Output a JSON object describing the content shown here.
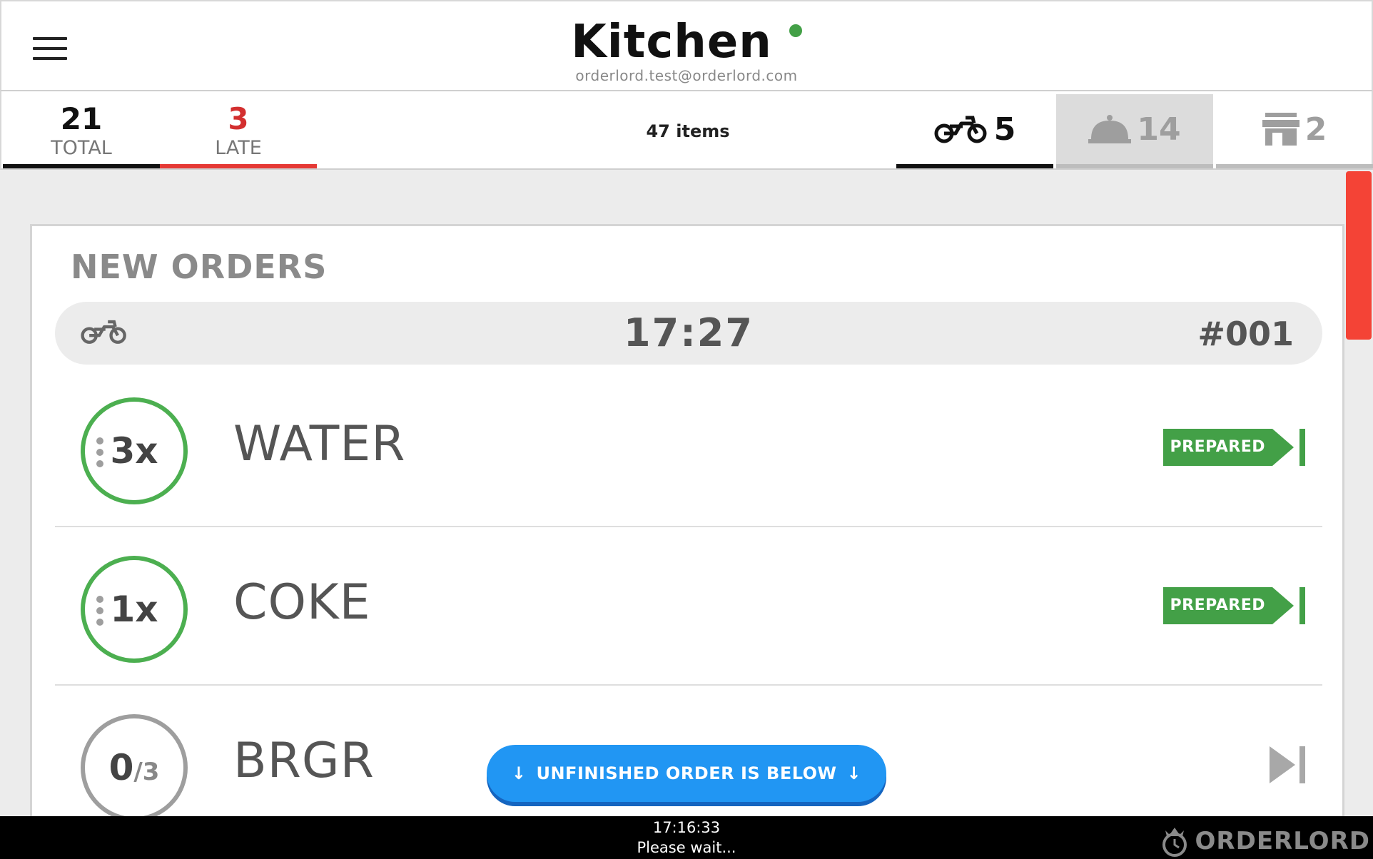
{
  "header": {
    "title": "Kitchen",
    "subtitle": "orderlord.test@orderlord.com",
    "status_color": "#43a047",
    "menu_icon": "hamburger-menu-icon"
  },
  "stats": {
    "total_count": "21",
    "total_label": "TOTAL",
    "late_count": "3",
    "late_label": "LATE",
    "items_count": "47 items",
    "delivery_count": "5",
    "dinein_count": "14",
    "takeaway_count": "2",
    "delivery_icon": "scooter-icon",
    "dinein_icon": "food-cloche-icon",
    "takeaway_icon": "storefront-icon"
  },
  "main": {
    "section_title": "NEW ORDERS",
    "order": {
      "type_icon": "scooter-icon",
      "time": "17:27",
      "number": "#001"
    },
    "items": [
      {
        "qty": "3x",
        "name": "WATER",
        "action": "PREPARED",
        "state": "prepared"
      },
      {
        "qty": "1x",
        "name": "COKE",
        "action": "PREPARED",
        "state": "prepared"
      },
      {
        "qty_done": "0",
        "qty_total": "/3",
        "name": "BRGR",
        "state": "pending"
      }
    ]
  },
  "floating_button": {
    "label": "UNFINISHED ORDER IS BELOW",
    "arrow_left": "↓",
    "arrow_right": "↓"
  },
  "footer": {
    "time": "17:16:33",
    "status": "Please wait...",
    "brand": "ORDERLORD"
  },
  "colors": {
    "accent_green": "#43a047",
    "late_red": "#d32f2f",
    "scroll_red": "#f44336",
    "button_blue": "#2196f3"
  }
}
